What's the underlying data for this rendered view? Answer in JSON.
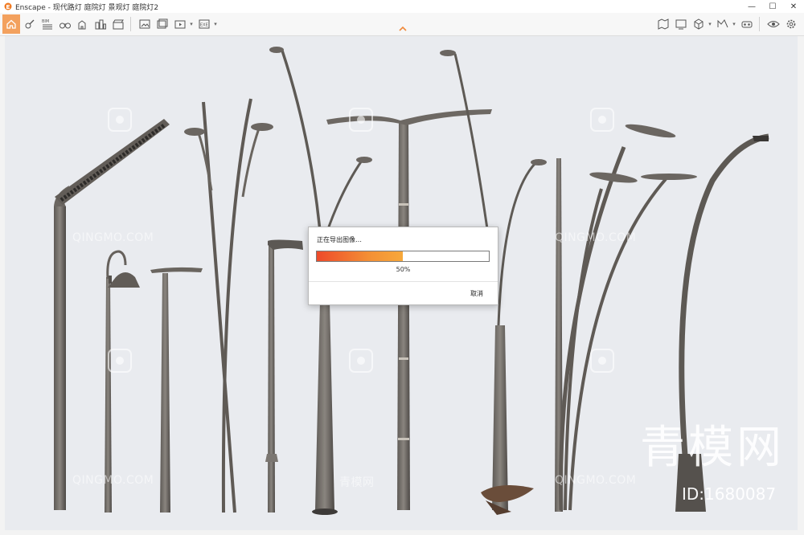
{
  "window": {
    "title": "Enscape - 现代路灯 庭院灯 景观灯 庭院灯2",
    "minimize_glyph": "—",
    "maximize_glyph": "☐",
    "close_glyph": "✕"
  },
  "toolbar": {
    "left_icons": [
      "home-icon",
      "asset-library-icon",
      "bim-icon",
      "binoculars-icon",
      "buildings-icon",
      "city-icon",
      "clapper-icon",
      "export-image-icon",
      "export-batch-icon",
      "export-video-icon",
      "export-exe-icon"
    ],
    "right_icons": [
      "map-icon",
      "screen-icon",
      "cube-icon",
      "pano-icon",
      "vr-icon",
      "eye-icon",
      "settings-icon"
    ],
    "accent_color": "#f3a15e"
  },
  "dialog": {
    "title": "正在导出图像…",
    "progress": 0.5,
    "progress_label": "50%",
    "cancel_label": "取消"
  },
  "watermark": {
    "site_text": "QINGMO.COM",
    "site_text_cn": "青模网",
    "brand_big": "青模网",
    "id_text": "ID:1680087"
  }
}
